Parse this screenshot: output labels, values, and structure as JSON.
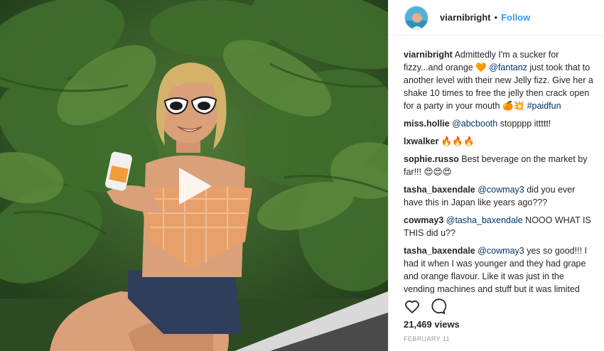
{
  "header": {
    "username": "viarnibright",
    "dot": "•",
    "follow_label": "Follow"
  },
  "caption": {
    "user": "viarnibright",
    "text_1": "Admittedly I'm a sucker for fizzy...and orange 🧡",
    "mention": "@fantanz",
    "text_2": "just took that to another level with their new Jelly fizz. Give her a shake 10 times to free the jelly then crack open for a party in your mouth 🍊💥",
    "hashtag": "#paidfun"
  },
  "comments": [
    {
      "user": "miss.hollie",
      "mention": "@abcbooth",
      "text": "stopppp ittttt!"
    },
    {
      "user": "lxwalker",
      "mention": "",
      "text": "🔥🔥🔥"
    },
    {
      "user": "sophie.russo",
      "mention": "",
      "text": "Best beverage on the market by far!!! 😍😍😍"
    },
    {
      "user": "tasha_baxendale",
      "mention": "@cowmay3",
      "text": "did you ever have this in Japan like years ago???"
    },
    {
      "user": "cowmay3",
      "mention": "@tasha_baxendale",
      "text": "NOOO WHAT IS THIS did u??"
    },
    {
      "user": "tasha_baxendale",
      "mention": "@cowmay3",
      "text": "yes so good!!! I had it when I was younger and they had grape and orange flavour. Like it was just in the vending machines and stuff but it was limited edition so they don't have it anymore."
    }
  ],
  "actions": {
    "like_icon": "heart-icon",
    "comment_icon": "comment-bubble-icon"
  },
  "stats": {
    "views": "21,469 views",
    "date": "FEBRUARY 11"
  },
  "media": {
    "play_icon": "play-icon"
  },
  "colors": {
    "link": "#3897f0",
    "mention": "#003569",
    "muted": "#999999",
    "border": "#efefef"
  }
}
